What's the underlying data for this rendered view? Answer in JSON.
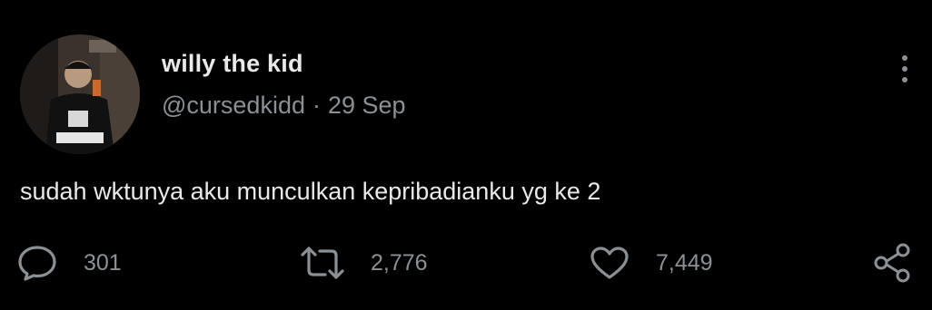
{
  "tweet": {
    "display_name": "willy the kid",
    "handle": "@cursedkidd",
    "separator": "·",
    "date": "29 Sep",
    "text": "sudah wktunya aku munculkan kepribadianku yg ke 2"
  },
  "actions": {
    "reply_count": "301",
    "retweet_count": "2,776",
    "like_count": "7,449"
  },
  "icons": {
    "more": "more-vertical-icon",
    "reply": "reply-bubble-icon",
    "retweet": "retweet-icon",
    "like": "heart-icon",
    "share": "share-icon"
  },
  "colors": {
    "background": "#000000",
    "primary_text": "#e7e9ea",
    "secondary_text": "#8b9095"
  }
}
